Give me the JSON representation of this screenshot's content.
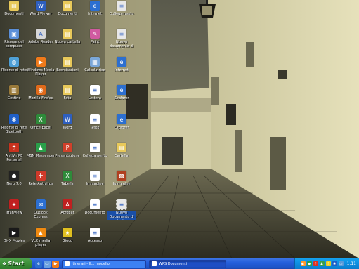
{
  "desktop": {
    "icons": [
      {
        "label": "Documenti",
        "color": "#e8c95a",
        "glyph": "▤",
        "col": 0,
        "row": 0
      },
      {
        "label": "Risorse del computer",
        "color": "#5b8fd8",
        "glyph": "▣",
        "col": 0,
        "row": 1
      },
      {
        "label": "Risorse di rete",
        "color": "#4fa0d6",
        "glyph": "◍",
        "col": 0,
        "row": 2
      },
      {
        "label": "Cestino",
        "color": "#9a7a3a",
        "glyph": "▥",
        "col": 0,
        "row": 3
      },
      {
        "label": "Risorse di rete Bluetooth",
        "color": "#1f5fc7",
        "glyph": "✱",
        "col": 0,
        "row": 4
      },
      {
        "label": "AntiVir PE Personal",
        "color": "#c8321e",
        "glyph": "☂",
        "col": 0,
        "row": 5
      },
      {
        "label": "Nero 7.0",
        "color": "#222222",
        "glyph": "●",
        "col": 0,
        "row": 6
      },
      {
        "label": "IrfanView",
        "color": "#c02020",
        "glyph": "✦",
        "col": 0,
        "row": 7
      },
      {
        "label": "DivX Movies",
        "color": "#1a1a1a",
        "glyph": "▶",
        "col": 0,
        "row": 8
      },
      {
        "label": "Word Viewer",
        "color": "#2e5fbf",
        "glyph": "W",
        "col": 1,
        "row": 0
      },
      {
        "label": "Adobe Reader",
        "color": "#d7d7d7",
        "glyph": "A",
        "col": 1,
        "row": 1
      },
      {
        "label": "Windows Media Player",
        "color": "#f07a1a",
        "glyph": "▶",
        "col": 1,
        "row": 2
      },
      {
        "label": "Mozilla Firefox",
        "color": "#e06a1a",
        "glyph": "◉",
        "col": 1,
        "row": 3
      },
      {
        "label": "Office Excel",
        "color": "#2e8b3a",
        "glyph": "X",
        "col": 1,
        "row": 4
      },
      {
        "label": "MSN Messenger",
        "color": "#2aa04a",
        "glyph": "♟",
        "col": 1,
        "row": 5
      },
      {
        "label": "Rete Antivirus",
        "color": "#d03a2a",
        "glyph": "✚",
        "col": 1,
        "row": 6
      },
      {
        "label": "Outlook Express",
        "color": "#2c6fd0",
        "glyph": "✉",
        "col": 1,
        "row": 7
      },
      {
        "label": "VLC media player",
        "color": "#f08a10",
        "glyph": "▲",
        "col": 1,
        "row": 8
      },
      {
        "label": "Documenti",
        "color": "#e8c95a",
        "glyph": "▤",
        "col": 2,
        "row": 0
      },
      {
        "label": "Nuova cartella",
        "color": "#e8c95a",
        "glyph": "▤",
        "col": 2,
        "row": 1
      },
      {
        "label": "Esercitazioni",
        "color": "#e8c95a",
        "glyph": "▤",
        "col": 2,
        "row": 2
      },
      {
        "label": "Foto",
        "color": "#e8c95a",
        "glyph": "▤",
        "col": 2,
        "row": 3
      },
      {
        "label": "Word",
        "color": "#2e5fbf",
        "glyph": "W",
        "col": 2,
        "row": 4
      },
      {
        "label": "Presentazione",
        "color": "#d0402a",
        "glyph": "P",
        "col": 2,
        "row": 5
      },
      {
        "label": "Tabella",
        "color": "#2e8b3a",
        "glyph": "X",
        "col": 2,
        "row": 6
      },
      {
        "label": "Acrobat",
        "color": "#c02020",
        "glyph": "A",
        "col": 2,
        "row": 7
      },
      {
        "label": "Gioco",
        "color": "#e0c020",
        "glyph": "★",
        "col": 2,
        "row": 8
      },
      {
        "label": "Internet",
        "color": "#2c6fd0",
        "glyph": "e",
        "col": 3,
        "row": 0
      },
      {
        "label": "Paint",
        "color": "#d05aa0",
        "glyph": "✎",
        "col": 3,
        "row": 1
      },
      {
        "label": "Calcolatrice",
        "color": "#7aa7d8",
        "glyph": "▦",
        "col": 3,
        "row": 2
      },
      {
        "label": "Lettera",
        "color": "#ffffff",
        "glyph": "≡",
        "col": 3,
        "row": 3
      },
      {
        "label": "Testo",
        "color": "#ffffff",
        "glyph": "≡",
        "col": 3,
        "row": 4
      },
      {
        "label": "Collegamento",
        "color": "#ffffff",
        "glyph": "≡",
        "col": 3,
        "row": 5
      },
      {
        "label": "Immagine",
        "color": "#ffffff",
        "glyph": "≡",
        "col": 3,
        "row": 6
      },
      {
        "label": "Documento",
        "color": "#ffffff",
        "glyph": "≡",
        "col": 3,
        "row": 7
      },
      {
        "label": "Accesso",
        "color": "#ffffff",
        "glyph": "≡",
        "col": 3,
        "row": 8
      },
      {
        "label": "Collegamento",
        "color": "#e8e8e8",
        "glyph": "≡",
        "col": 4,
        "row": 0
      },
      {
        "label": "Nuovo documento di testo",
        "color": "#e8e8e8",
        "glyph": "≡",
        "col": 4,
        "row": 1
      },
      {
        "label": "Internet",
        "color": "#2c6fd0",
        "glyph": "e",
        "col": 4,
        "row": 2
      },
      {
        "label": "Explorer",
        "color": "#2c6fd0",
        "glyph": "e",
        "col": 4,
        "row": 3
      },
      {
        "label": "Explorer",
        "color": "#2c6fd0",
        "glyph": "e",
        "col": 4,
        "row": 4
      },
      {
        "label": "Cartella",
        "color": "#e8c95a",
        "glyph": "▤",
        "col": 4,
        "row": 5
      },
      {
        "label": "Immagine",
        "color": "#b04020",
        "glyph": "▩",
        "col": 4,
        "row": 6
      },
      {
        "label": "Nuovo Documento di testo",
        "color": "#e8e8e8",
        "glyph": "≡",
        "col": 4,
        "row": 7,
        "selected": true
      }
    ]
  },
  "taskbar": {
    "start_label": "Start",
    "quicklaunch": [
      {
        "name": "browser",
        "color": "#2c6fd0",
        "glyph": "e"
      },
      {
        "name": "desktop",
        "color": "#6aa0e0",
        "glyph": "▭"
      },
      {
        "name": "media",
        "color": "#f07a1a",
        "glyph": "▶"
      }
    ],
    "tasks": [
      {
        "label": "Itinerari - Il... modello",
        "active": false
      },
      {
        "label": "WPS Documenti",
        "active": true
      }
    ],
    "tray_icons": [
      {
        "name": "volume",
        "color": "#ff9a2a",
        "glyph": "◐"
      },
      {
        "name": "network",
        "color": "#2aa04a",
        "glyph": "◆"
      },
      {
        "name": "antivirus",
        "color": "#e03020",
        "glyph": "☂"
      },
      {
        "name": "messenger",
        "color": "#3aa04a",
        "glyph": "♟"
      },
      {
        "name": "updates",
        "color": "#f0d020",
        "glyph": "!"
      },
      {
        "name": "bluetooth",
        "color": "#1f5fc7",
        "glyph": "✱"
      },
      {
        "name": "display",
        "color": "#5a9ad8",
        "glyph": "▭"
      }
    ],
    "clock": "1.11"
  }
}
